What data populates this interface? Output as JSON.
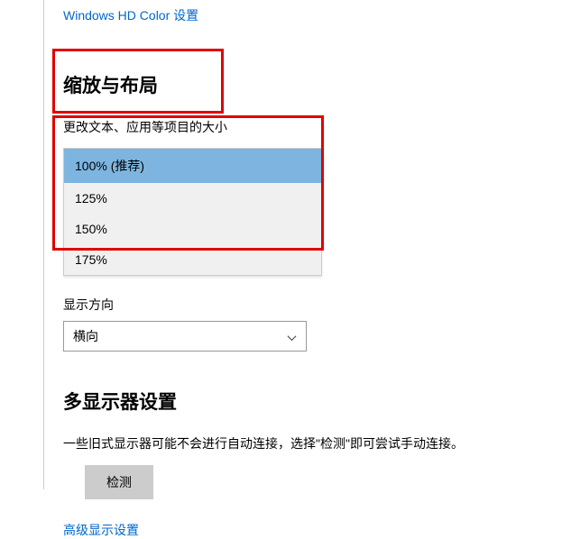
{
  "links": {
    "hdcolor": "Windows HD Color 设置",
    "advanced": "高级显示设置"
  },
  "scale": {
    "heading": "缩放与布局",
    "label": "更改文本、应用等项目的大小",
    "options": [
      "100% (推荐)",
      "125%",
      "150%",
      "175%"
    ],
    "selectedIndex": 0
  },
  "orientation": {
    "label": "显示方向",
    "value": "横向"
  },
  "multimonitor": {
    "heading": "多显示器设置",
    "body": "一些旧式显示器可能不会进行自动连接，选择\"检测\"即可尝试手动连接。",
    "detectButton": "检测"
  }
}
